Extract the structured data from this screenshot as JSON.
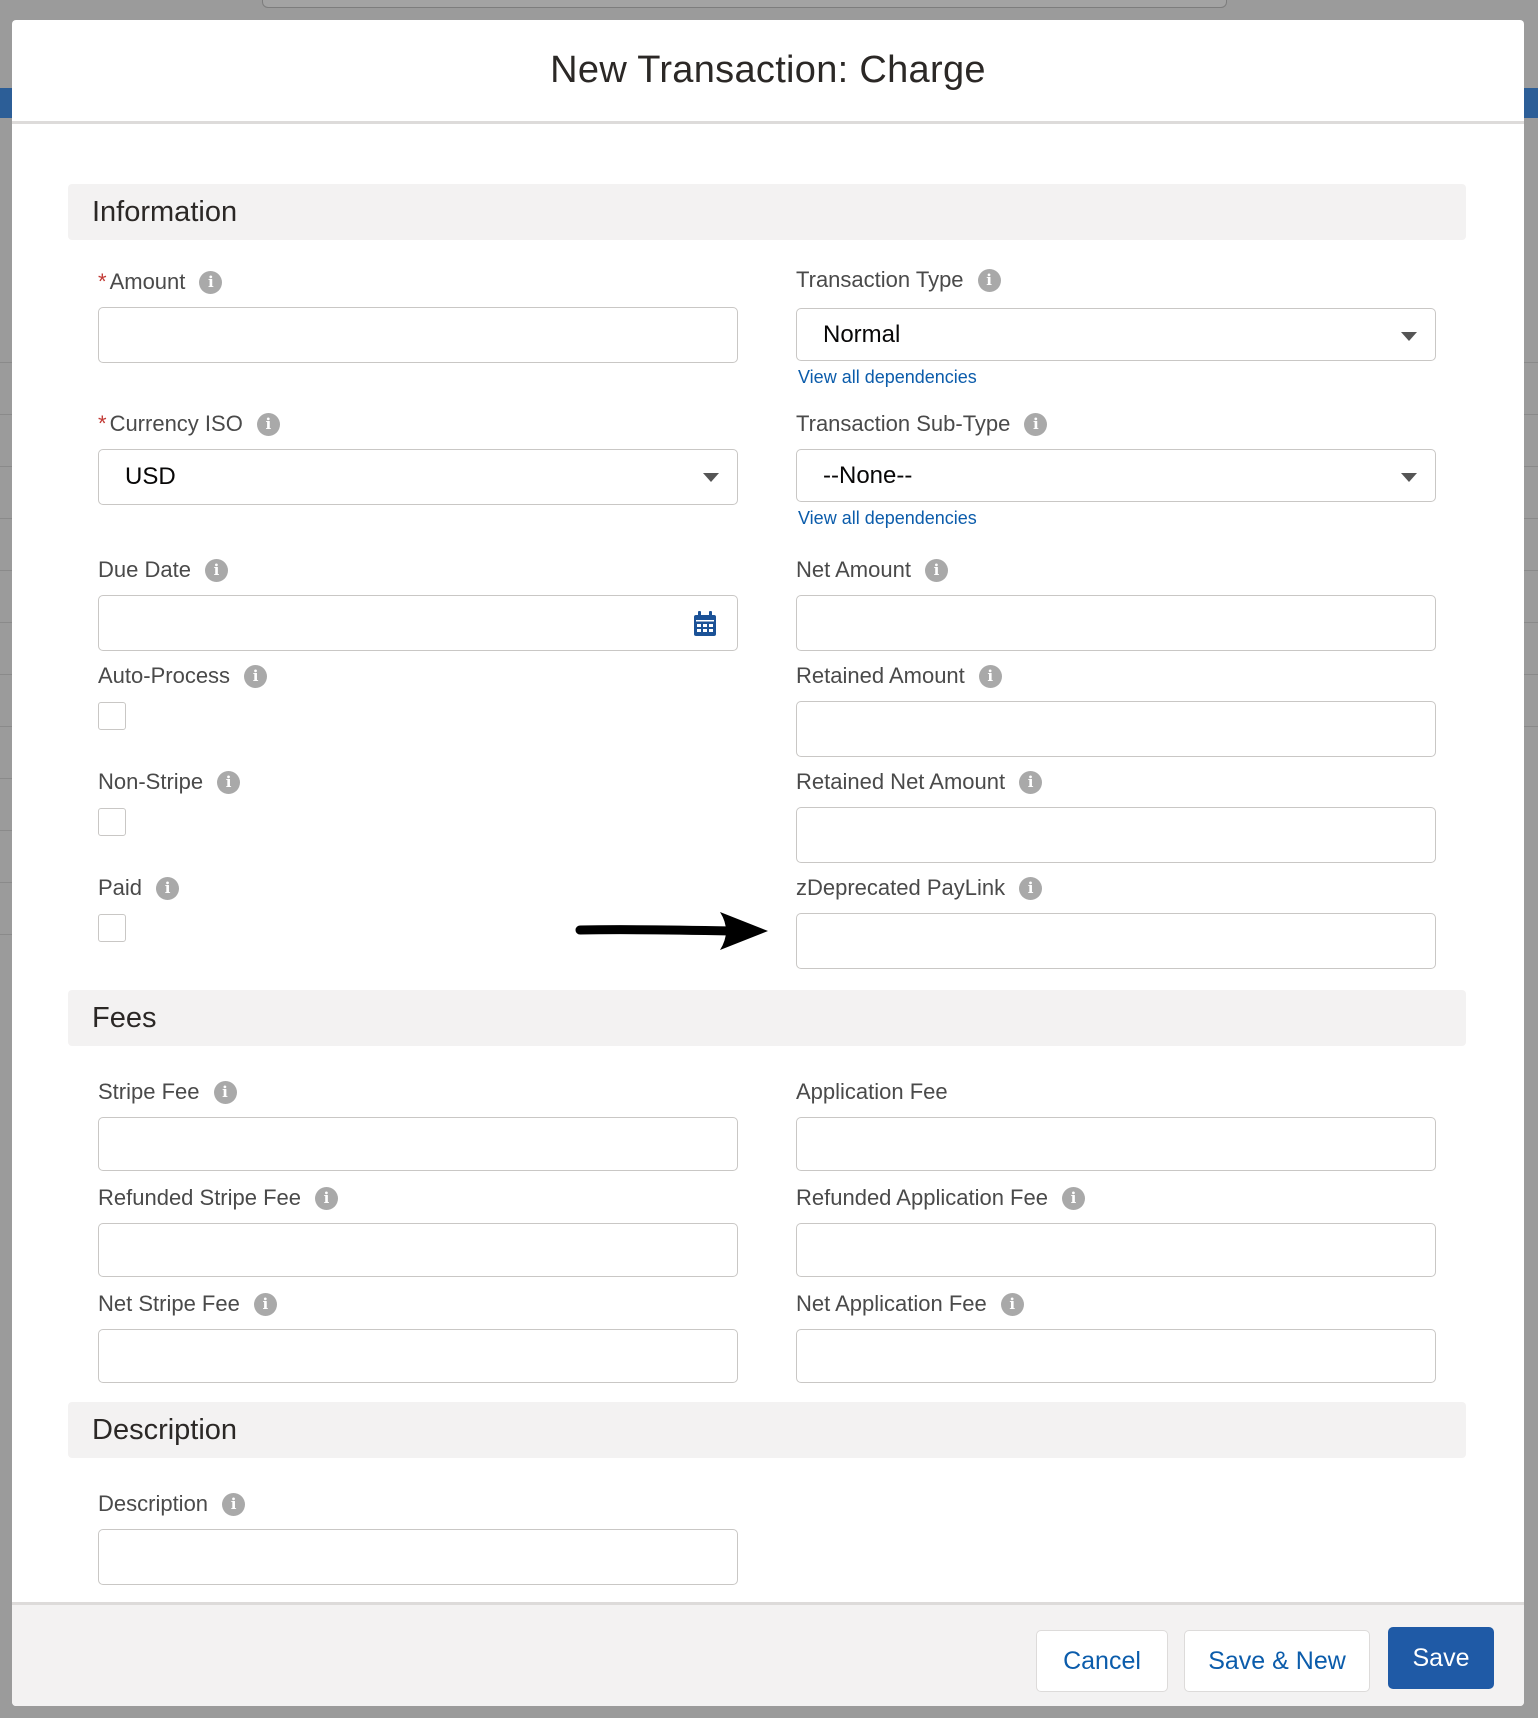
{
  "modal": {
    "title": "New Transaction: Charge"
  },
  "sections": {
    "information": "Information",
    "fees": "Fees",
    "description": "Description"
  },
  "fields": {
    "amount": {
      "label": "Amount",
      "required": true,
      "value": ""
    },
    "currency_iso": {
      "label": "Currency ISO",
      "required": true,
      "value": "USD"
    },
    "due_date": {
      "label": "Due Date",
      "value": ""
    },
    "auto_process": {
      "label": "Auto-Process",
      "checked": false
    },
    "non_stripe": {
      "label": "Non-Stripe",
      "checked": false
    },
    "paid": {
      "label": "Paid",
      "checked": false
    },
    "transaction_type": {
      "label": "Transaction Type",
      "value": "Normal",
      "link": "View all dependencies"
    },
    "transaction_sub_type": {
      "label": "Transaction Sub-Type",
      "value": "--None--",
      "link": "View all dependencies"
    },
    "net_amount": {
      "label": "Net Amount",
      "value": ""
    },
    "retained_amount": {
      "label": "Retained Amount",
      "value": ""
    },
    "retained_net_amount": {
      "label": "Retained Net Amount",
      "value": ""
    },
    "zdeprecated_paylink": {
      "label": "zDeprecated PayLink",
      "value": ""
    },
    "stripe_fee": {
      "label": "Stripe Fee",
      "value": ""
    },
    "refunded_stripe_fee": {
      "label": "Refunded Stripe Fee",
      "value": ""
    },
    "net_stripe_fee": {
      "label": "Net Stripe Fee",
      "value": ""
    },
    "application_fee": {
      "label": "Application Fee",
      "value": ""
    },
    "refunded_application_fee": {
      "label": "Refunded Application Fee",
      "value": ""
    },
    "net_application_fee": {
      "label": "Net Application Fee",
      "value": ""
    },
    "description": {
      "label": "Description",
      "value": ""
    }
  },
  "icons": {
    "info": "info-icon",
    "calendar": "calendar-icon",
    "dropdown": "chevron-down-icon",
    "annotation": "arrow-right-icon"
  },
  "footer": {
    "cancel_label": "Cancel",
    "save_new_label": "Save & New",
    "save_label": "Save"
  },
  "colors": {
    "brand": "#1f5aa6",
    "link": "#0b5cab",
    "required": "#c23934",
    "section_bg": "#f3f2f2"
  }
}
